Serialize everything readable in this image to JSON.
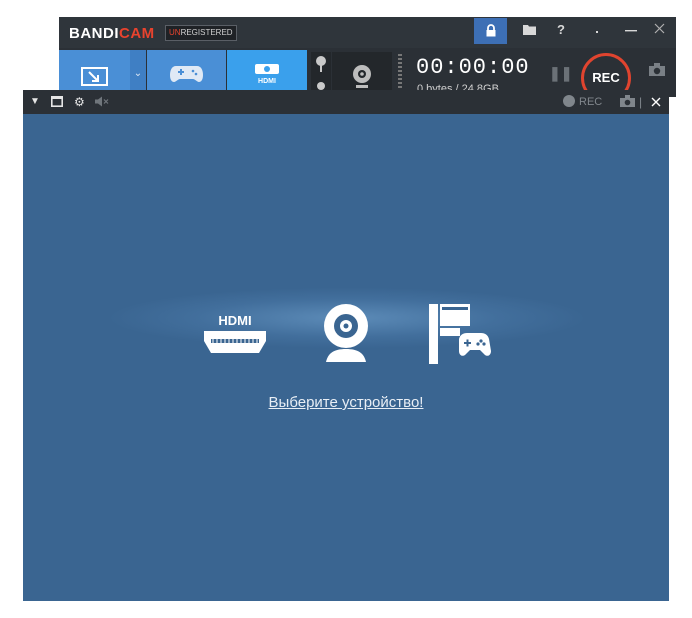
{
  "main_window": {
    "logo_white": "BANDI",
    "logo_red": "CAM",
    "unregistered_un": "UN",
    "unregistered_rest": "REGISTERED",
    "help_label": "?",
    "timer": "00:00:00",
    "size_text": "0 bytes / 24.8GB",
    "rec_label": "REC"
  },
  "hdmi_window": {
    "rec_label": "REC",
    "select_device_link": "Выберите устройство!",
    "hdmi_label": "HDMI"
  },
  "colors": {
    "accent_blue": "#4a8fd6",
    "hdmi_mode_blue": "#3aa0ec",
    "rec_red": "#e0442f",
    "panel_blue": "#3a6591",
    "dark_bar": "#2b3036"
  }
}
